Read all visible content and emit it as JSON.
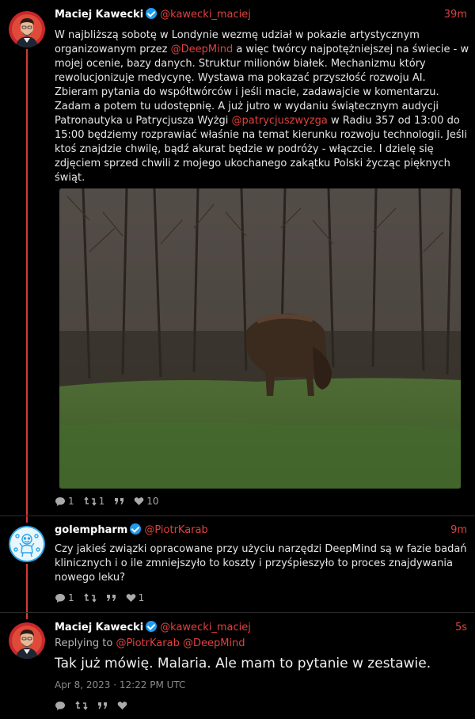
{
  "tweets": [
    {
      "name": "Maciej Kawecki",
      "handle": "@kawecki_maciej",
      "time": "39m",
      "text_parts": [
        "W najbliższą sobotę w Londynie wezmę udział w pokazie artystycznym organizowanym przez ",
        "@DeepMind",
        " a więc twórcy najpotężniejszej na świecie - w mojej ocenie, bazy danych. Struktur milionów białek. Mechanizmu który rewolucjonizuje medycynę. Wystawa ma pokazać przyszłość rozwoju AI. Zbieram pytania do współtwórców i jeśli macie, zadawajcie w komentarzu. Zadam a potem tu udostępnię. A już jutro w wydaniu świątecznym audycji Patronautyka u Patrycjusza Wyżgi ",
        "@patrycjuszwyzga",
        " w Radiu 357 od 13:00 do 15:00 będziemy rozprawiać właśnie na temat kierunku rozwoju technologii. Jeśli ktoś znajdzie chwilę, bądź akurat będzie w podróży - włączcie. I dzielę się zdjęciem sprzed chwili z mojego ukochanego zakątku Polski życząc pięknych świąt."
      ],
      "replies": "1",
      "retweets": "1",
      "likes": "10"
    },
    {
      "name": "golempharm",
      "handle": "@PiotrKarab",
      "time": "9m",
      "text": "Czy jakieś związki opracowane przy użyciu narzędzi DeepMind są w fazie badań klinicznych i o ile zmniejszyło to koszty i przyśpieszyło to proces znajdywania nowego leku?",
      "replies": "1",
      "likes": "1"
    },
    {
      "name": "Maciej Kawecki",
      "handle": "@kawecki_maciej",
      "time": "5s",
      "replying_label": "Replying to",
      "replying_mentions": "@PiotrKarab @DeepMind",
      "text": "Tak już mówię. Malaria. Ale mam to pytanie w zestawie.",
      "timestamp": "Apr 8, 2023 · 12:22 PM UTC"
    }
  ],
  "colors": {
    "accent": "#e0413f",
    "thread": "#d13b3b",
    "verified": "#1d9bf0",
    "background": "#000000"
  },
  "icons": [
    "comment-icon",
    "retweet-icon",
    "quote-icon",
    "heart-icon",
    "verified-icon"
  ]
}
